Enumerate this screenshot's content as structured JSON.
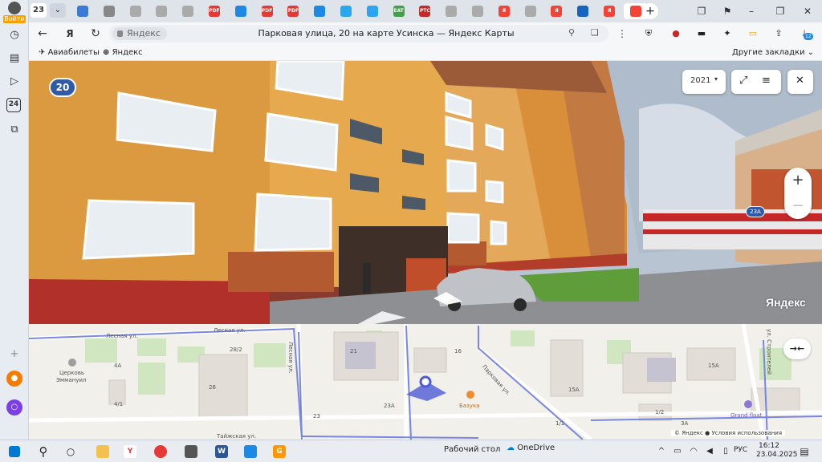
{
  "rail": {
    "login_label": "Войти",
    "bottom_badge": "24"
  },
  "tabs": {
    "count": "23",
    "items": [
      {
        "icon": "yandex-disk-icon",
        "color": "#3a7bd5",
        "text": ""
      },
      {
        "icon": "document-icon",
        "color": "#888888",
        "text": ""
      },
      {
        "icon": "document-icon",
        "color": "#aaaaaa",
        "text": ""
      },
      {
        "icon": "document-icon",
        "color": "#aaaaaa",
        "text": ""
      },
      {
        "icon": "document-icon",
        "color": "#aaaaaa",
        "text": ""
      },
      {
        "icon": "pdf-icon",
        "color": "#e53935",
        "text": "PDF"
      },
      {
        "icon": "mail-icon",
        "color": "#1e88e5",
        "text": ""
      },
      {
        "icon": "pdf-icon",
        "color": "#e53935",
        "text": "PDF"
      },
      {
        "icon": "pdf-icon",
        "color": "#e53935",
        "text": "PDF"
      },
      {
        "icon": "mail-icon",
        "color": "#1e88e5",
        "text": ""
      },
      {
        "icon": "telegram-icon",
        "color": "#29a9eb",
        "text": ""
      },
      {
        "icon": "app-icon",
        "color": "#2ea3f2",
        "text": ""
      },
      {
        "icon": "eat-icon",
        "color": "#43a047",
        "text": "EAT"
      },
      {
        "icon": "rts-icon",
        "color": "#c62828",
        "text": "РТС"
      },
      {
        "icon": "document-icon",
        "color": "#aaaaaa",
        "text": ""
      },
      {
        "icon": "document-icon",
        "color": "#aaaaaa",
        "text": ""
      },
      {
        "icon": "yandex-icon",
        "color": "#f44336",
        "text": "Я"
      },
      {
        "icon": "document-icon",
        "color": "#aaaaaa",
        "text": ""
      },
      {
        "icon": "yandex-icon",
        "color": "#f44336",
        "text": "Я"
      },
      {
        "icon": "shield-icon",
        "color": "#1565c0",
        "text": ""
      },
      {
        "icon": "yandex-icon",
        "color": "#f44336",
        "text": "Я"
      },
      {
        "icon": "yandex-maps-icon",
        "color": "#f44336",
        "text": "",
        "active": true
      }
    ]
  },
  "address_bar": {
    "site_label": "Яндекс",
    "page_title": "Парковая улица, 20 на карте Усинска — Яндекс Карты"
  },
  "extensions": {
    "download_badge": "12"
  },
  "bookmarks": {
    "items": [
      "Авиабилеты",
      "Яндекс"
    ],
    "other": "Другие закладки"
  },
  "panorama": {
    "year": "2021",
    "house_badge": "20",
    "neighbor_badge": "23A",
    "watermark": "Яндекс",
    "zoom_in": "+",
    "zoom_out": "−"
  },
  "map": {
    "labels": [
      {
        "text": "Лесная ул.",
        "key": "a"
      },
      {
        "text": "Лесная ул.",
        "key": "b"
      },
      {
        "text": "Церковь",
        "key": "c"
      },
      {
        "text": "Эммануил",
        "key": "d"
      },
      {
        "text": "28/2",
        "key": "e"
      },
      {
        "text": "4А",
        "key": "f"
      },
      {
        "text": "26",
        "key": "g"
      },
      {
        "text": "4/1",
        "key": "h"
      },
      {
        "text": "Тайжская ул.",
        "key": "i"
      },
      {
        "text": "Лесная ул.",
        "key": "j"
      },
      {
        "text": "23",
        "key": "k"
      },
      {
        "text": "23А",
        "key": "l"
      },
      {
        "text": "21",
        "key": "m"
      },
      {
        "text": "16",
        "key": "n"
      },
      {
        "text": "Парковая ул.",
        "key": "o"
      },
      {
        "text": "Базука",
        "key": "p"
      },
      {
        "text": "15А",
        "key": "q"
      },
      {
        "text": "15А",
        "key": "r"
      },
      {
        "text": "1/2",
        "key": "s"
      },
      {
        "text": "1/1",
        "key": "t"
      },
      {
        "text": "3А",
        "key": "u"
      },
      {
        "text": "Grand float",
        "key": "v"
      },
      {
        "text": "ул. Строителей",
        "key": "w"
      }
    ],
    "copyright": "© Яндекс",
    "terms": "Условия использования"
  },
  "taskbar": {
    "desktop_label": "Рабочий стол",
    "onedrive_label": "OneDrive",
    "lang": "РУС",
    "time": "16:12",
    "date": "23.04.2025"
  }
}
